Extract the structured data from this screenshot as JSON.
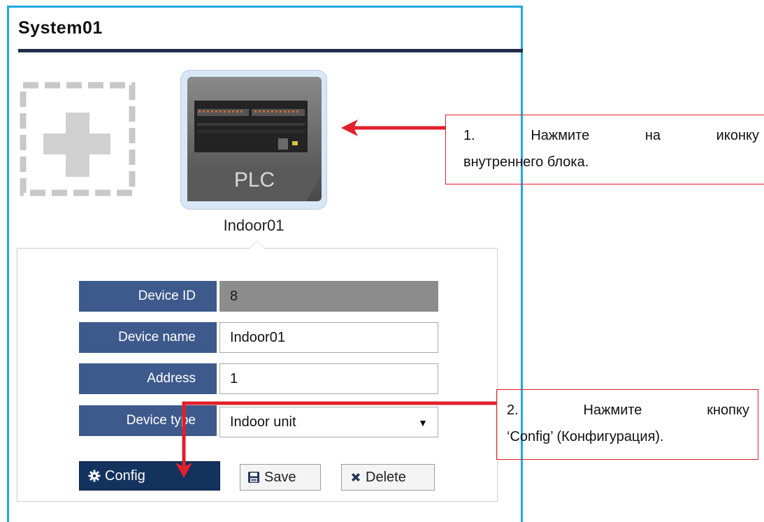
{
  "system": {
    "title": "System01"
  },
  "device_tile": {
    "badge": "PLC",
    "caption": "Indoor01"
  },
  "form": {
    "device_id": {
      "label": "Device ID",
      "value": "8"
    },
    "device_name": {
      "label": "Device name",
      "value": "Indoor01"
    },
    "address": {
      "label": "Address",
      "value": "1"
    },
    "device_type": {
      "label": "Device type",
      "value": "Indoor unit",
      "arrow": "▼"
    }
  },
  "buttons": {
    "config": {
      "label": "Config",
      "icon": "gear-icon"
    },
    "save": {
      "label": "Save",
      "icon": "floppy-disk-icon"
    },
    "delete": {
      "label": "Delete",
      "icon": "x-icon"
    }
  },
  "annotations": {
    "step1": {
      "line1": [
        "1.",
        "Нажмите",
        "на",
        "иконку"
      ],
      "line2": "внутреннего блока."
    },
    "step2": {
      "line1": [
        "2.",
        "Нажмите",
        "кнопку"
      ],
      "line2": "‘Config’ (Конфигурация)."
    }
  },
  "colors": {
    "panel_border": "#1ea8e0",
    "label_bg": "#3e5a8c",
    "config_bg": "#14325e",
    "annotation_red": "#e0202a"
  }
}
